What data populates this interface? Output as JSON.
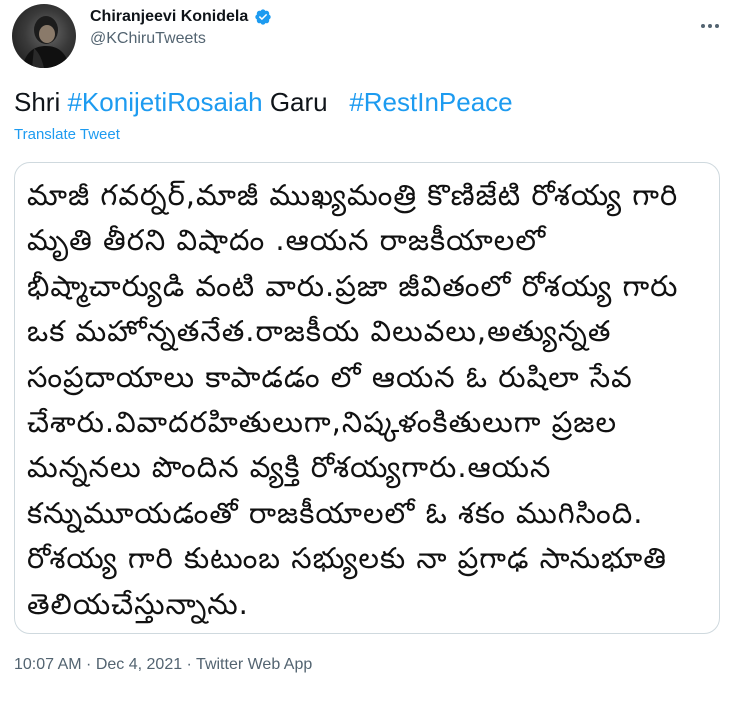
{
  "author": {
    "display_name": "Chiranjeevi Konidela",
    "handle": "@KChiruTweets",
    "verified_icon": "verified-badge-icon",
    "verified_color": "#1d9bf0"
  },
  "tweet": {
    "prefix": "Shri ",
    "hashtag1": "#KonijetiRosaiah",
    "middle": " Garu   ",
    "hashtag2": "#RestInPeace",
    "translate_label": "Translate Tweet",
    "hashtag_color": "#1d9bf0"
  },
  "media": {
    "lines": [
      "మాజీ గవర్నర్,మాజీ ముఖ్యమంత్రి కొణిజేటి రోశయ్య గారి",
      "మృతి తీరని విషాదం .ఆయన రాజకీయాలలో",
      "భీష్మాచార్యుడి వంటి వారు.ప్రజా జీవితంలో రోశయ్య గారు",
      "ఒక మహోన్నతనేత.రాజకీయ విలువలు,అత్యున్నత",
      "సంప్రదాయాలు కాపాడడం లో ఆయన ఓ రుషిలా సేవ",
      "చేశారు.వివాదరహితులుగా,నిష్కళంకితులుగా ప్రజల",
      "మన్ననలు పొందిన వ్యక్తి రోశయ్యగారు.ఆయన",
      "కన్నుమూయడంతో రాజకీయాలలో ఓ శకం ముగిసింది.",
      "రోశయ్య గారి కుటుంబ సభ్యులకు నా ప్రగాఢ సానుభూతి",
      "తెలియచేస్తున్నాను."
    ]
  },
  "meta": {
    "time": "10:07 AM",
    "separator": " · ",
    "date": "Dec 4, 2021",
    "source": "Twitter Web App"
  },
  "icons": {
    "more": "more-options-icon",
    "avatar": "avatar"
  }
}
